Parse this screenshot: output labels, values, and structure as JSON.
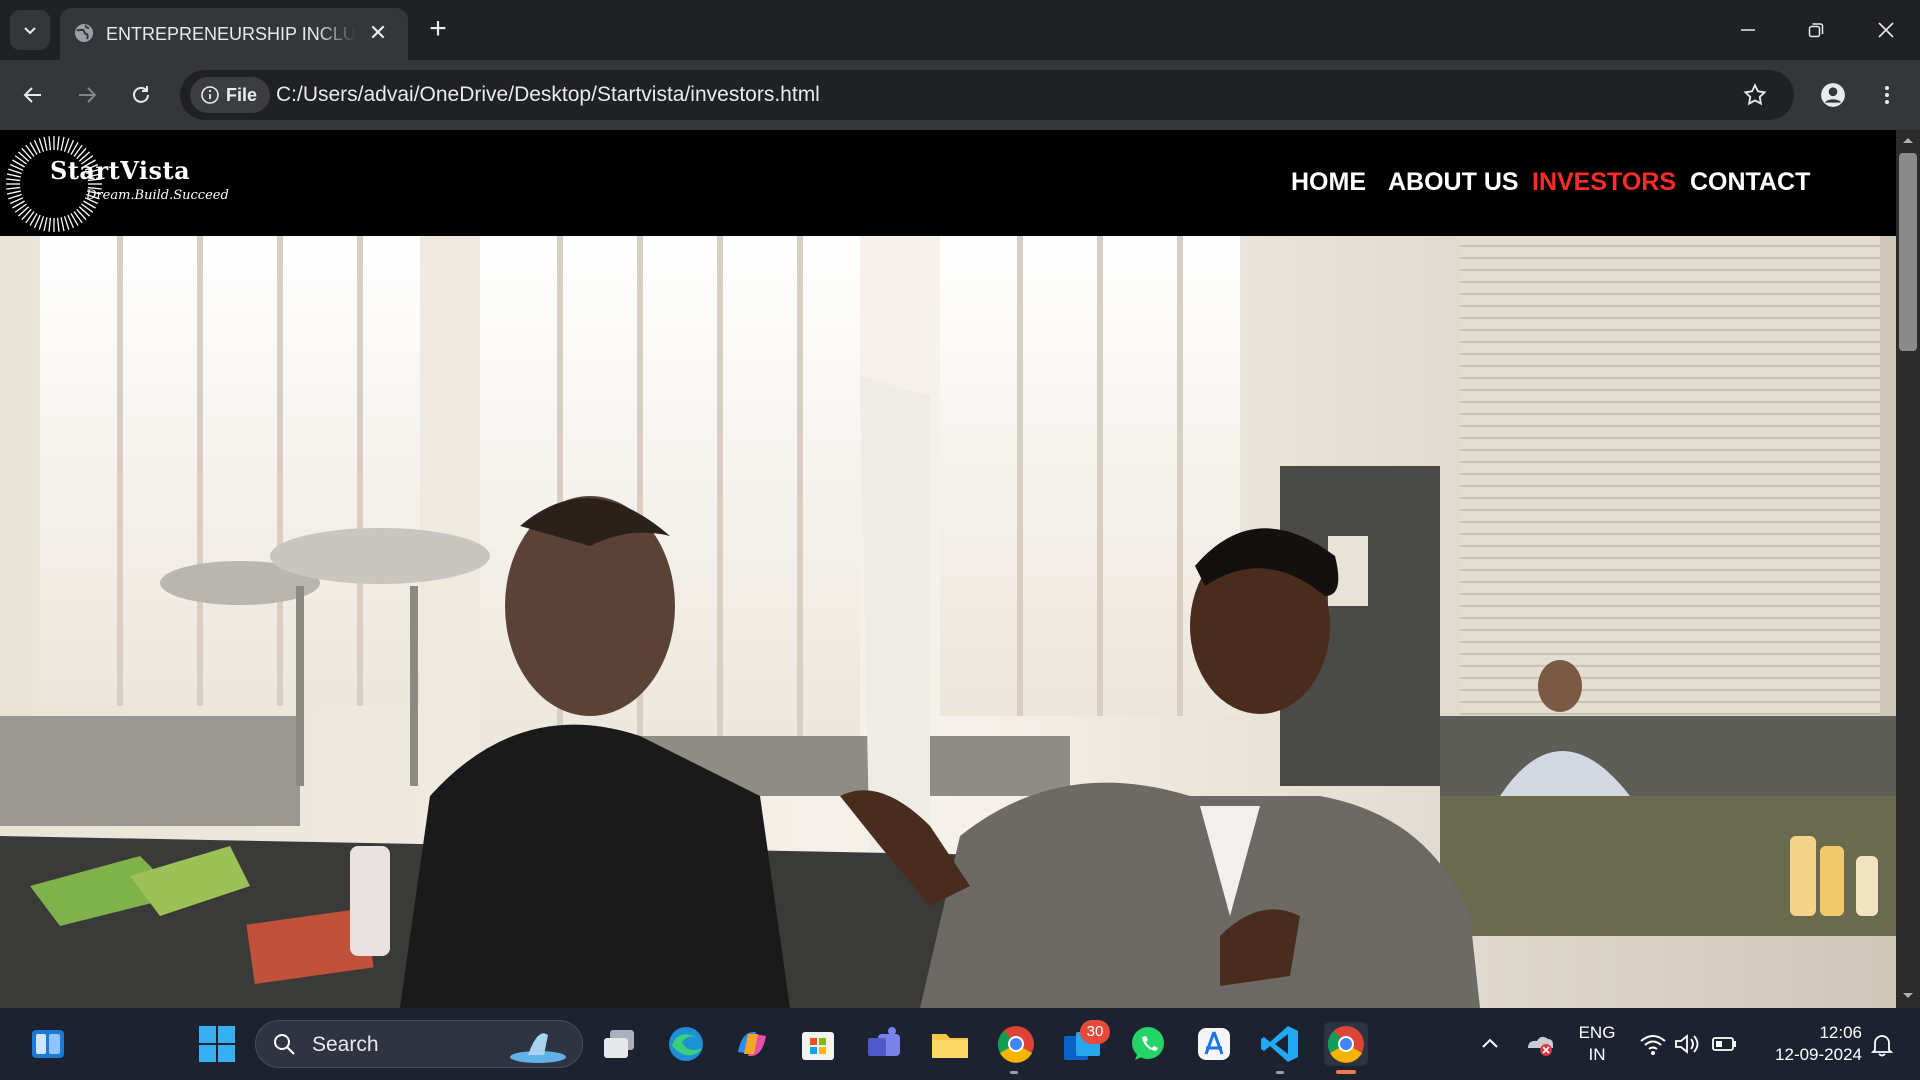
{
  "browser": {
    "tab_title": "ENTREPRENEURSHIP INCLUBATOR",
    "close_glyph": "✕",
    "new_tab_glyph": "+",
    "address_chip": "File",
    "url": "C:/Users/advai/OneDrive/Desktop/Startvista/investors.html"
  },
  "site": {
    "brand_name": "StartVista",
    "tagline": "Dream.Build.Succeed",
    "nav": [
      {
        "label": "HOME",
        "active": false
      },
      {
        "label": "ABOUT US",
        "active": false
      },
      {
        "label": "INVESTORS",
        "active": true
      },
      {
        "label": "CONTACT",
        "active": false
      }
    ],
    "active_color": "#ff2a2a"
  },
  "taskbar": {
    "search_label": "Search",
    "badge_count": "30",
    "language": "ENG",
    "region": "IN",
    "time": "12:06",
    "date": "12-09-2024",
    "apps": [
      "widgets-icon",
      "start-icon",
      "task-view-icon",
      "edge-icon",
      "copilot-icon",
      "store-icon",
      "teams-icon",
      "file-explorer-icon",
      "chrome-icon",
      "outlook-icon",
      "whatsapp-icon",
      "app-icon",
      "vscode-icon",
      "chrome-active-icon"
    ]
  }
}
